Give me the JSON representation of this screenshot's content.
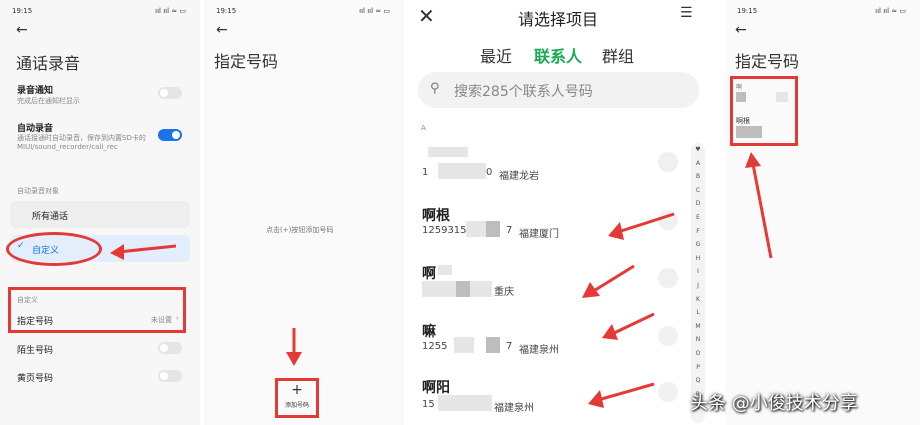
{
  "panel1": {
    "status_time": "19:15",
    "status_icons": "ııl ııl ≈ ▭",
    "title": "通话录音",
    "record_notice_title": "录音通知",
    "record_notice_desc": "完成后在通知栏显示",
    "auto_record_title": "自动录音",
    "auto_record_desc": "通话接通时自动录音，保存到内置SD卡的MIUI/sound_recorder/call_rec",
    "auto_target_label": "自动录音对象",
    "option_all": "所有通话",
    "option_custom": "自定义",
    "custom_section": "自定义",
    "specified_number": "指定号码",
    "specified_status": "未设置",
    "stranger_number": "陌生号码",
    "yellowpage_number": "黄页号码"
  },
  "panel2": {
    "status_time": "19:15",
    "status_icons": "ııl ııl ≈ ▭",
    "title": "指定号码",
    "hint": "点击(+)按钮添加号码",
    "add_label": "添加号码",
    "add_symbol": "+"
  },
  "panel3": {
    "title": "请选择项目",
    "tabs": [
      "最近",
      "联系人",
      "群组"
    ],
    "search_placeholder": "搜索285个联系人号码",
    "section": "A",
    "contacts": [
      {
        "name": "",
        "number": "1",
        "suffix": "0",
        "location": "福建龙岩"
      },
      {
        "name": "啊根",
        "number": "1259315",
        "suffix": "7",
        "location": "福建厦门"
      },
      {
        "name": "啊",
        "number": "",
        "suffix": "",
        "location": "重庆"
      },
      {
        "name": "嘛",
        "number": "1255",
        "suffix": "7",
        "location": "福建泉州"
      },
      {
        "name": "啊阳",
        "number": "15",
        "suffix": "",
        "location": "福建泉州"
      }
    ],
    "alphabet": [
      "♥",
      "A",
      "B",
      "C",
      "D",
      "E",
      "F",
      "G",
      "H",
      "I",
      "J",
      "K",
      "L",
      "M",
      "N",
      "O",
      "P",
      "Q",
      "R",
      "S"
    ]
  },
  "panel4": {
    "status_time": "19:15",
    "status_icons": "ııl ııl ≈ ▭",
    "title": "指定号码",
    "entry1_label": "啊",
    "entry2_label": "啊根"
  },
  "watermark": "头条 @小俊技术分享",
  "colors": {
    "accent_blue": "#1a73e8",
    "accent_green": "#1aaa55",
    "annotation_red": "#e53935"
  }
}
